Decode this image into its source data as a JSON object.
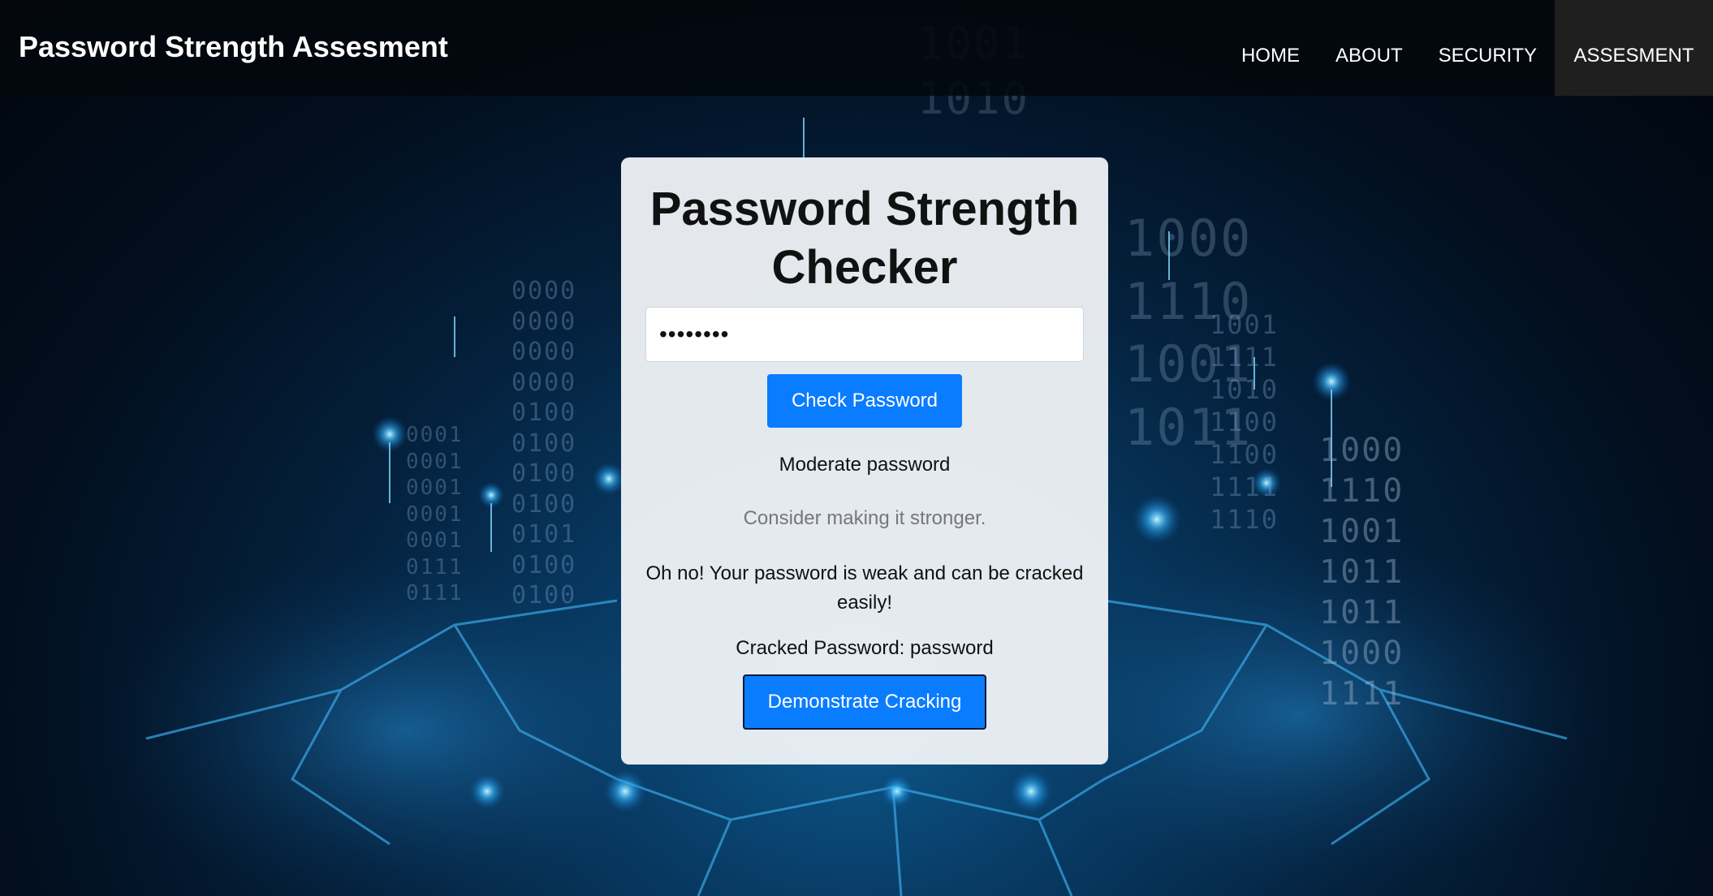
{
  "navbar": {
    "brand": "Password Strength Assesment",
    "links": [
      {
        "label": "HOME"
      },
      {
        "label": "ABOUT"
      },
      {
        "label": "SECURITY"
      },
      {
        "label": "ASSESMENT",
        "active": true
      }
    ]
  },
  "checker": {
    "title": "Password Strength Checker",
    "password_value": "••••••••",
    "check_button": "Check Password",
    "strength_message": "Moderate password",
    "hint_message": "Consider making it stronger.",
    "weak_message": "Oh no! Your password is weak and can be cracked easily!",
    "cracked_password": "Cracked Password: password",
    "demo_button": "Demonstrate Cracking"
  },
  "colors": {
    "accent": "#0a7cff",
    "navbar": "#03080e",
    "card": "#f0f3f7"
  }
}
